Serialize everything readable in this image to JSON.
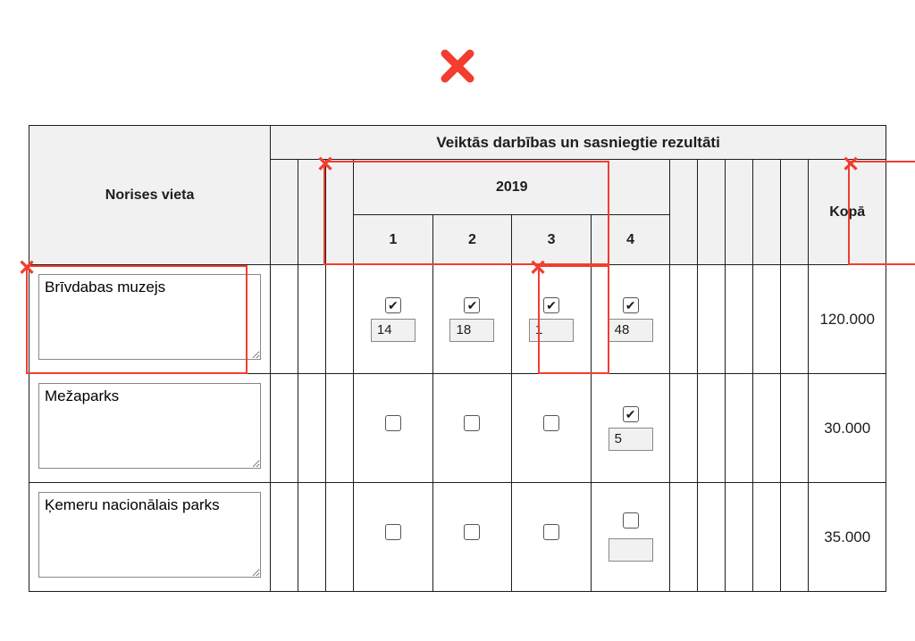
{
  "check_glyph": "✔",
  "headers": {
    "name": "Norises vieta",
    "top": "Veiktās darbības un sasniegtie rezultāti",
    "year": "2019",
    "q1": "1",
    "q2": "2",
    "q3": "3",
    "q4": "4",
    "total": "Kopā"
  },
  "rows": [
    {
      "name": "Brīvdabas muzejs",
      "q": [
        {
          "checked": true,
          "value": "14"
        },
        {
          "checked": true,
          "value": "18"
        },
        {
          "checked": true,
          "value": "1"
        },
        {
          "checked": true,
          "value": "48"
        }
      ],
      "total": "120.000"
    },
    {
      "name": "Mežaparks",
      "q": [
        {
          "checked": false,
          "value": null
        },
        {
          "checked": false,
          "value": null
        },
        {
          "checked": false,
          "value": null
        },
        {
          "checked": true,
          "value": "5"
        }
      ],
      "total": "30.000"
    },
    {
      "name": "Ķemeru nacionālais parks",
      "q": [
        {
          "checked": false,
          "value": null
        },
        {
          "checked": false,
          "value": null
        },
        {
          "checked": false,
          "value": null
        },
        {
          "checked": false,
          "value": ""
        }
      ],
      "total": "35.000"
    }
  ]
}
